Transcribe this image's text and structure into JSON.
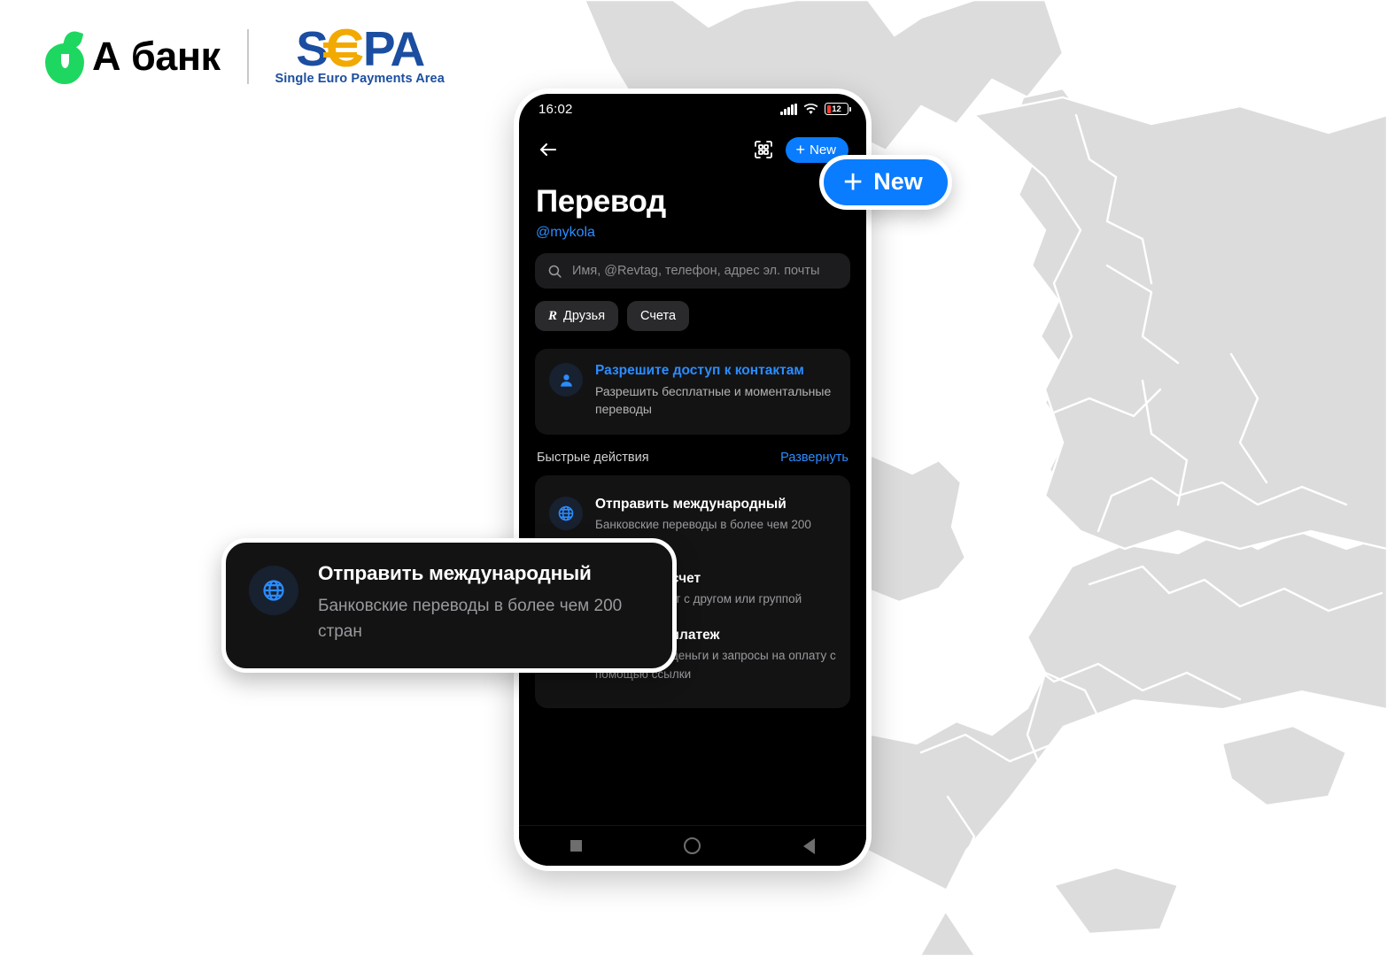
{
  "brand": {
    "bank_name": "А банк",
    "apple_icon": "apple-logo-icon",
    "sepa": {
      "s": "S",
      "euro": "€",
      "pa": "PA",
      "tagline": "Single Euro Payments Area"
    }
  },
  "phone": {
    "statusbar": {
      "time": "16:02",
      "signal_icon": "cellular-signal-icon",
      "wifi_icon": "wifi-icon",
      "battery_level": "12"
    },
    "nav": {
      "back_icon": "arrow-left-icon",
      "qr_icon": "qr-scan-icon",
      "new_button_label": "New",
      "new_button_plus": "+"
    },
    "title": "Перевод",
    "revtag": "@mykola",
    "search": {
      "icon": "search-icon",
      "placeholder": "Имя, @Revtag, телефон, адрес эл. почты"
    },
    "chips": [
      {
        "label": "Друзья",
        "icon": "revolut-r-icon",
        "selected": true
      },
      {
        "label": "Счета",
        "icon": "",
        "selected": false
      }
    ],
    "contacts_card": {
      "icon": "person-icon",
      "title": "Разрешите доступ к контактам",
      "subtitle": "Разрешить бесплатные и моментальные переводы"
    },
    "quick_actions": {
      "section_title": "Быстрые действия",
      "action_label": "Развернуть",
      "items": [
        {
          "icon": "globe-icon",
          "title": "Отправить международный",
          "subtitle": "Банковские переводы в более чем 200 стран"
        },
        {
          "icon": "split-bill-icon",
          "title": "Разделить счет",
          "subtitle": "Разделите счет с другом или группой"
        },
        {
          "icon": "link-icon",
          "title": "Ссылка на платеж",
          "subtitle": "Отправляйте деньги и запросы на оплату с помощью ссылки"
        }
      ]
    },
    "android_nav": {
      "recents_icon": "square-icon",
      "home_icon": "circle-icon",
      "back_icon": "triangle-back-icon"
    }
  },
  "callouts": {
    "new_button": {
      "plus": "+",
      "label": "New"
    },
    "international": {
      "icon": "globe-icon",
      "title": "Отправить международный",
      "subtitle": "Банковские переводы в более чем 200 стран"
    }
  },
  "colors": {
    "accent_blue": "#0a7cff",
    "link_blue": "#2b8cff",
    "brand_green": "#1ed760",
    "sepa_blue": "#1b4ea0",
    "sepa_gold": "#f2a900",
    "screen_bg": "#000000",
    "card_bg": "#131314",
    "map_land": "#dcdcdc",
    "map_border": "#ffffff"
  }
}
